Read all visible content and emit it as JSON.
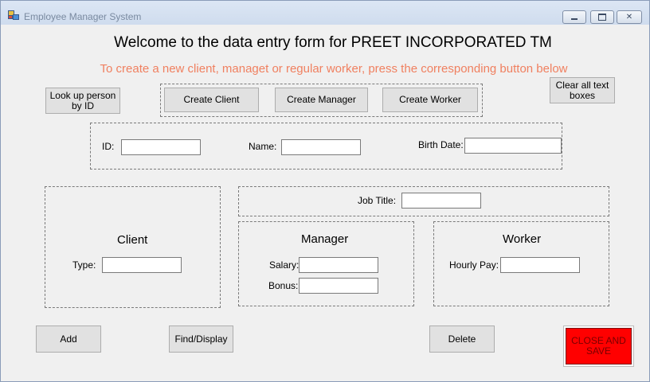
{
  "window": {
    "title": "Employee Manager System"
  },
  "header": {
    "welcome": "Welcome to the data entry form for PREET INCORPORATED TM",
    "instruction": "To create a new client, managet or regular worker, press the corresponding button below"
  },
  "buttons": {
    "lookup": "Look up person by ID",
    "create_client": "Create Client",
    "create_manager": "Create Manager",
    "create_worker": "Create Worker",
    "clear_all": "Clear all text boxes",
    "add": "Add",
    "find_display": "Find/Display",
    "delete": "Delete",
    "close_save": "CLOSE AND SAVE"
  },
  "fields": {
    "id": {
      "label": "ID:",
      "value": ""
    },
    "name": {
      "label": "Name:",
      "value": ""
    },
    "birth_date": {
      "label": "Birth Date:",
      "value": ""
    },
    "job_title": {
      "label": "Job Title:",
      "value": ""
    },
    "type": {
      "label": "Type:",
      "value": ""
    },
    "salary": {
      "label": "Salary:",
      "value": ""
    },
    "bonus": {
      "label": "Bonus:",
      "value": ""
    },
    "hourly_pay": {
      "label": "Hourly Pay:",
      "value": ""
    }
  },
  "groups": {
    "client": "Client",
    "manager": "Manager",
    "worker": "Worker"
  },
  "colors": {
    "instruction_text": "#f08060",
    "close_button": "#ff0000",
    "form_background": "#f0f0f0"
  }
}
